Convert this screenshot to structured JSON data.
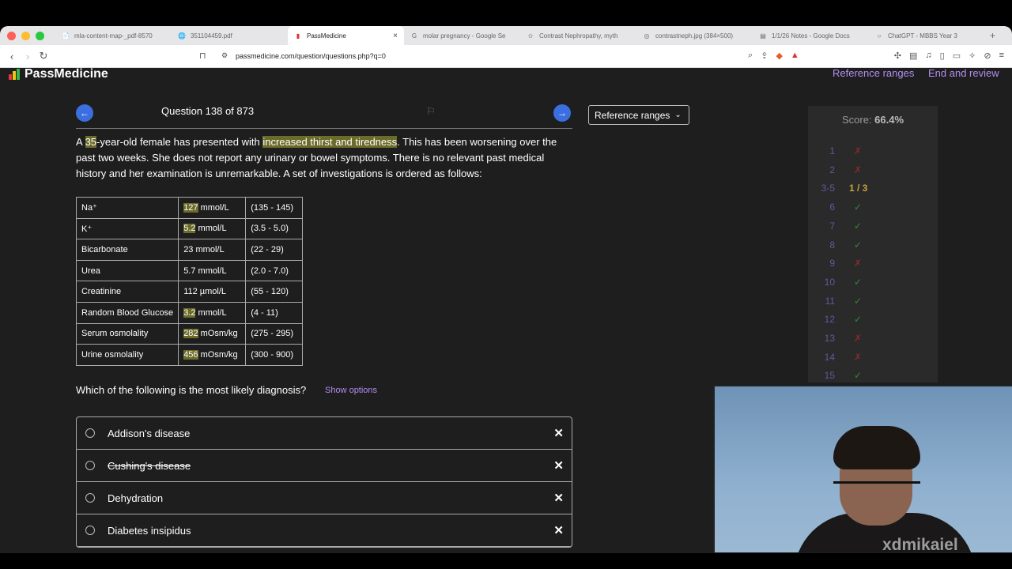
{
  "browser": {
    "tabs": [
      {
        "title": "mla-content-map-_pdf-8570",
        "active": false
      },
      {
        "title": "351104459.pdf",
        "active": false
      },
      {
        "title": "PassMedicine",
        "active": true
      },
      {
        "title": "molar pregnancy - Google Se",
        "active": false
      },
      {
        "title": "Contrast Nephropathy, myth",
        "active": false
      },
      {
        "title": "contrastneph.jpg (384×500)",
        "active": false
      },
      {
        "title": "1/1/26 Notes - Google Docs",
        "active": false
      },
      {
        "title": "ChatGPT - MBBS Year 3",
        "active": false
      }
    ],
    "url": "passmedicine.com/question/questions.php?q=0"
  },
  "header": {
    "logo": "PassMedicine",
    "reference_ranges_link": "Reference ranges",
    "end_review_link": "End and review"
  },
  "question": {
    "title": "Question 138 of 873",
    "reference_button": "Reference ranges",
    "stem": {
      "p1": "A ",
      "age": "35",
      "p2": "-year-old female has presented with ",
      "symptoms": "increased thirst and tiredness",
      "p3": ". This has been worsening over the past two weeks. She does not report any urinary or bowel symptoms. There is no relevant past medical history and her examination is unremarkable. A set of investigations is ordered as follows:"
    },
    "labs": [
      {
        "name": "Na⁺",
        "value": "127",
        "unit": " mmol/L",
        "range": "(135 - 145)",
        "highlight": true
      },
      {
        "name": "K⁺",
        "value": "5.2",
        "unit": " mmol/L",
        "range": "(3.5 - 5.0)",
        "highlight": true
      },
      {
        "name": "Bicarbonate",
        "value": "23",
        "unit": " mmol/L",
        "range": "(22 - 29)",
        "highlight": false
      },
      {
        "name": "Urea",
        "value": "5.7",
        "unit": " mmol/L",
        "range": "(2.0 - 7.0)",
        "highlight": false
      },
      {
        "name": "Creatinine",
        "value": "112",
        "unit": " µmol/L",
        "range": "(55 - 120)",
        "highlight": false
      },
      {
        "name": "Random Blood Glucose",
        "value": "3.2",
        "unit": " mmol/L",
        "range": "(4 - 11)",
        "highlight": true
      },
      {
        "name": "Serum osmolality",
        "value": "282",
        "unit": " mOsm/kg",
        "range": "(275 - 295)",
        "highlight": true
      },
      {
        "name": "Urine osmolality",
        "value": "456",
        "unit": " mOsm/kg",
        "range": "(300 - 900)",
        "highlight": true
      }
    ],
    "prompt": "Which of the following is the most likely diagnosis?",
    "show_options": "Show options",
    "options": [
      {
        "label": "Addison's disease",
        "struck": false
      },
      {
        "label": "Cushing's disease",
        "struck": true
      },
      {
        "label": "Dehydration",
        "struck": false
      },
      {
        "label": "Diabetes insipidus",
        "struck": false
      }
    ]
  },
  "score_panel": {
    "score_label": "Score: ",
    "score_value": "66.4%",
    "rows": [
      {
        "n": "1",
        "mark": "✗",
        "status": "cross"
      },
      {
        "n": "2",
        "mark": "✗",
        "status": "cross"
      },
      {
        "n": "3-5",
        "mark": "1 / 3",
        "status": "part"
      },
      {
        "n": "6",
        "mark": "✓",
        "status": "check"
      },
      {
        "n": "7",
        "mark": "✓",
        "status": "check"
      },
      {
        "n": "8",
        "mark": "✓",
        "status": "check"
      },
      {
        "n": "9",
        "mark": "✗",
        "status": "cross"
      },
      {
        "n": "10",
        "mark": "✓",
        "status": "check"
      },
      {
        "n": "11",
        "mark": "✓",
        "status": "check"
      },
      {
        "n": "12",
        "mark": "✓",
        "status": "check"
      },
      {
        "n": "13",
        "mark": "✗",
        "status": "cross"
      },
      {
        "n": "14",
        "mark": "✗",
        "status": "cross"
      },
      {
        "n": "15",
        "mark": "✓",
        "status": "check"
      }
    ]
  },
  "overlay": {
    "watermark": "xdmikaiel"
  },
  "colors": {
    "accent_purple": "#b48cf2",
    "nav_blue": "#3b6fe0",
    "highlight": "#6b6b2a",
    "page_bg": "#1e1e1e"
  }
}
